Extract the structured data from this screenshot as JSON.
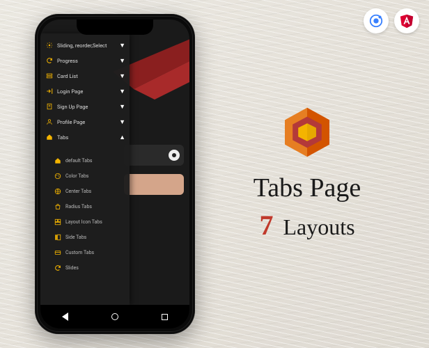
{
  "promo": {
    "title": "Tabs Page",
    "count": "7",
    "subtitle_rest": " Layouts"
  },
  "drawer": {
    "items": [
      {
        "icon": "gear",
        "label": "Sliding, reorder,Select",
        "chev": "down"
      },
      {
        "icon": "refresh",
        "label": "Progress",
        "chev": "down"
      },
      {
        "icon": "cardlist",
        "label": "Card List",
        "chev": "down"
      },
      {
        "icon": "login",
        "label": "Login Page",
        "chev": "down"
      },
      {
        "icon": "signup",
        "label": "Sign Up Page",
        "chev": "down"
      },
      {
        "icon": "profile",
        "label": "Profile Page",
        "chev": "down"
      },
      {
        "icon": "home",
        "label": "Tabs",
        "chev": "up"
      }
    ],
    "sub_items": [
      {
        "icon": "home",
        "label": "default Tabs"
      },
      {
        "icon": "palette",
        "label": "Color Tabs"
      },
      {
        "icon": "globe",
        "label": "Center Tabs"
      },
      {
        "icon": "bag",
        "label": "Radius Tabs"
      },
      {
        "icon": "layout",
        "label": "Layout Icon Tabs"
      },
      {
        "icon": "side",
        "label": "Side Tabs"
      },
      {
        "icon": "card",
        "label": "Custom Tabs"
      },
      {
        "icon": "refresh",
        "label": "Slides"
      }
    ]
  },
  "badges": {
    "ionic": "ionic-icon",
    "angular": "angular-icon"
  }
}
